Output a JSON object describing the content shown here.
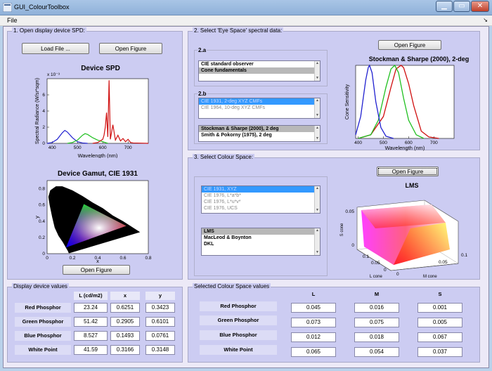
{
  "window": {
    "title": "GUI_ColourToolbox"
  },
  "menu": {
    "file": "File",
    "arrow": "↘"
  },
  "panel1": {
    "title": "1. Open display device SPD:",
    "load_button": "Load File ...",
    "open_figure": "Open Figure",
    "open_figure_2": "Open Figure"
  },
  "panel2": {
    "title": "2. Select 'Eye Space' spectral data:",
    "sub_a": "2.a",
    "sub_b": "2.b",
    "list_a": [
      "CIE standard observer",
      "Cone fundamentals"
    ],
    "list_b1": [
      "CIE 1931, 2-deg XYZ CMFs",
      "CIE 1964, 10-deg XYZ CMFs"
    ],
    "list_b2": [
      "Stockman & Sharpe (2000), 2 deg",
      "Smith & Pokorny (1975), 2 deg"
    ],
    "open_figure": "Open Figure"
  },
  "panel3": {
    "title": "3. Select Colour Space:",
    "list_1": [
      "CIE 1931, XYZ",
      "CIE 1976, L*a*b*",
      "CIE 1976, L*u*v*",
      "CIE 1976, UCS"
    ],
    "list_2": [
      "LMS",
      "MacLeod & Boynton",
      "DKL"
    ],
    "open_figure": "Open Figure"
  },
  "device_values": {
    "title": "Display device values",
    "headers": [
      "L (cd/m2)",
      "x",
      "y"
    ],
    "rows": [
      {
        "label": "Red Phosphor",
        "values": [
          "23.24",
          "0.6251",
          "0.3423"
        ]
      },
      {
        "label": "Green Phosphor",
        "values": [
          "51.42",
          "0.2905",
          "0.6101"
        ]
      },
      {
        "label": "Blue Phosphor",
        "values": [
          "8.527",
          "0.1493",
          "0.0761"
        ]
      },
      {
        "label": "White Point",
        "values": [
          "41.59",
          "0.3166",
          "0.3148"
        ]
      }
    ]
  },
  "space_values": {
    "title": "Selected Colour Space values",
    "headers": [
      "L",
      "M",
      "S"
    ],
    "rows": [
      {
        "label": "Red Phosphor",
        "values": [
          "0.045",
          "0.016",
          "0.001"
        ]
      },
      {
        "label": "Green Phosphor",
        "values": [
          "0.073",
          "0.075",
          "0.005"
        ]
      },
      {
        "label": "Blue Phosphor",
        "values": [
          "0.012",
          "0.018",
          "0.067"
        ]
      },
      {
        "label": "White Point",
        "values": [
          "0.065",
          "0.054",
          "0.037"
        ]
      }
    ]
  },
  "chart_data": [
    {
      "type": "line",
      "title": "Device SPD",
      "xlabel": "Wavelength (nm)",
      "ylabel": "Spectral Radiance (W/sr*sqm)",
      "y_exponent": "x 10⁻³",
      "xlim": [
        380,
        780
      ],
      "ylim": [
        0,
        8
      ],
      "xticks": [
        "400",
        "500",
        "600",
        "700"
      ],
      "yticks": [
        "0",
        "2",
        "4",
        "6"
      ],
      "series": [
        {
          "color": "#2020d0",
          "x": [
            380,
            400,
            420,
            440,
            450,
            460,
            480,
            500,
            520,
            540
          ],
          "y": [
            0,
            0.1,
            0.5,
            1.3,
            1.6,
            1.4,
            0.7,
            0.2,
            0.05,
            0
          ]
        },
        {
          "color": "#20c020",
          "x": [
            460,
            480,
            500,
            520,
            530,
            540,
            560,
            580,
            600,
            620
          ],
          "y": [
            0,
            0.1,
            0.4,
            1.0,
            1.2,
            1.1,
            0.7,
            0.4,
            0.2,
            0
          ]
        },
        {
          "color": "#d01010",
          "x": [
            560,
            580,
            590,
            600,
            605,
            610,
            615,
            620,
            625,
            630,
            640,
            650,
            660,
            670,
            680,
            690,
            700,
            710,
            720,
            780
          ],
          "y": [
            0,
            0.1,
            0.3,
            0.5,
            1.0,
            2.0,
            3.8,
            0.8,
            7.8,
            0.5,
            2.3,
            0.4,
            1.0,
            0.3,
            0.6,
            0.2,
            0.5,
            0.1,
            0.05,
            0
          ]
        }
      ]
    },
    {
      "type": "scatter",
      "title": "Device Gamut, CIE 1931",
      "xlabel": "x",
      "ylabel": "y",
      "xlim": [
        0,
        0.8
      ],
      "ylim": [
        0,
        0.9
      ],
      "xticks": [
        "0",
        "0.2",
        "0.4",
        "0.6",
        "0.8"
      ],
      "yticks": [
        "0",
        "0.2",
        "0.4",
        "0.6",
        "0.8"
      ],
      "gamut": [
        [
          0.6251,
          0.3423
        ],
        [
          0.2905,
          0.6101
        ],
        [
          0.1493,
          0.0761
        ]
      ]
    },
    {
      "type": "line",
      "title": "Stockman & Sharpe (2000), 2-deg",
      "xlabel": "Wavelength (nm)",
      "ylabel": "Cone Sensitivity",
      "xlim": [
        390,
        780
      ],
      "ylim": [
        0,
        1
      ],
      "xticks": [
        "400",
        "500",
        "600",
        "700"
      ],
      "series": [
        {
          "name": "",
          "color": "#d01010",
          "x": [
            400,
            450,
            500,
            530,
            550,
            570,
            580,
            600,
            620,
            650,
            680,
            720
          ],
          "y": [
            0,
            0.05,
            0.3,
            0.7,
            0.95,
            1.0,
            0.97,
            0.75,
            0.45,
            0.1,
            0.02,
            0
          ]
        },
        {
          "name": "",
          "color": "#20c020",
          "x": [
            400,
            450,
            480,
            510,
            530,
            545,
            560,
            580,
            600,
            630,
            660
          ],
          "y": [
            0,
            0.05,
            0.25,
            0.7,
            0.95,
            1.0,
            0.9,
            0.55,
            0.25,
            0.05,
            0
          ]
        },
        {
          "name": "",
          "color": "#2020d0",
          "x": [
            390,
            410,
            430,
            440,
            445,
            455,
            470,
            490,
            510,
            540
          ],
          "y": [
            0.05,
            0.3,
            0.8,
            0.97,
            1.0,
            0.9,
            0.5,
            0.15,
            0.03,
            0
          ]
        }
      ]
    },
    {
      "type": "scatter",
      "title": "LMS",
      "xlabel": "L cone",
      "ylabel": "S cone",
      "zlabel": "M cone",
      "xticks": [
        "0",
        "0.05",
        "0.1"
      ],
      "yticks": [
        "0",
        "0.05"
      ],
      "zticks": [
        "0",
        "0.05",
        "0.1"
      ]
    }
  ]
}
